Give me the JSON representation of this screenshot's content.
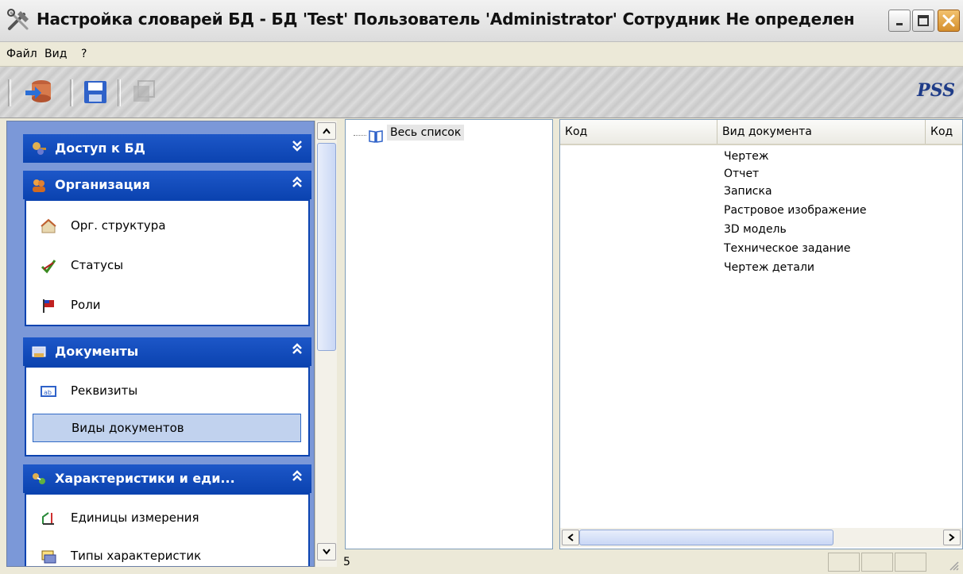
{
  "window": {
    "title": "Настройка словарей БД - БД 'Test' Пользователь 'Administrator' Сотрудник Не определен"
  },
  "menu": [
    "Файл",
    "Вид",
    "?"
  ],
  "toolbar": {
    "brand": "PSS",
    "buttons": [
      "connect-db-icon",
      "save-icon",
      "disabled-icon"
    ]
  },
  "sidebar": {
    "groups": [
      {
        "label": "Доступ к БД",
        "icon": "keys-icon",
        "expanded": false,
        "items": []
      },
      {
        "label": "Организация",
        "icon": "people-icon",
        "expanded": true,
        "items": [
          {
            "label": "Орг. структура",
            "icon": "house-icon"
          },
          {
            "label": "Статусы",
            "icon": "checkmark-icon"
          },
          {
            "label": "Роли",
            "icon": "flag-icon"
          }
        ]
      },
      {
        "label": "Документы",
        "icon": "documents-icon",
        "expanded": true,
        "items": [
          {
            "label": "Реквизиты",
            "icon": "form-field-icon"
          },
          {
            "label": "Виды документов",
            "icon": "",
            "selected": true
          }
        ]
      },
      {
        "label": "Характеристики и еди...",
        "icon": "characteristics-icon",
        "expanded": true,
        "items": [
          {
            "label": "Единицы измерения",
            "icon": "measure-icon"
          },
          {
            "label": "Типы характеристик",
            "icon": "types-icon"
          }
        ]
      }
    ]
  },
  "tree": {
    "root_label": "Весь список"
  },
  "table": {
    "columns": [
      "Код",
      "Вид документа",
      "Код"
    ],
    "rows": [
      {
        "code": "",
        "type": "Чертеж"
      },
      {
        "code": "",
        "type": "Отчет"
      },
      {
        "code": "",
        "type": "Записка"
      },
      {
        "code": "",
        "type": "Растровое изображение"
      },
      {
        "code": "",
        "type": "3D модель"
      },
      {
        "code": "",
        "type": "Техническое задание"
      },
      {
        "code": "",
        "type": "Чертеж детали"
      }
    ]
  },
  "status": {
    "count": "5"
  },
  "colors": {
    "group_header": "#0b43b0",
    "selected_item": "#c1d2ee",
    "sidebar_bg": "#7b98d8"
  }
}
